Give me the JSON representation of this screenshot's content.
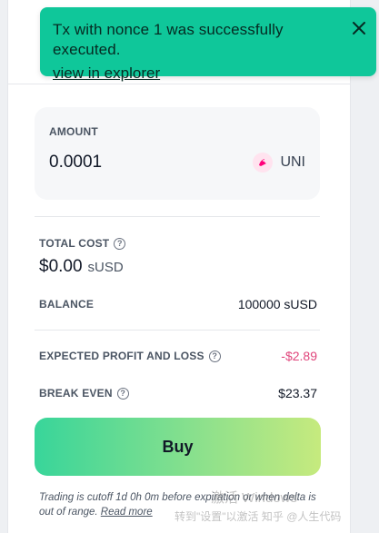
{
  "toast": {
    "title": "Tx with nonce 1 was successfully executed.",
    "link": "view in explorer"
  },
  "amount": {
    "label": "AMOUNT",
    "value": "0.0001",
    "token_symbol": "UNI",
    "token_icon": "uni-token-icon"
  },
  "total_cost": {
    "label": "TOTAL COST",
    "value": "$0.00",
    "unit": "sUSD"
  },
  "balance": {
    "label": "BALANCE",
    "value": "100000 sUSD"
  },
  "pnl": {
    "label": "EXPECTED PROFIT AND LOSS",
    "value": "-$2.89"
  },
  "break_even": {
    "label": "BREAK EVEN",
    "value": "$23.37"
  },
  "buy_button": "Buy",
  "note": {
    "text": "Trading is cutoff 1d 0h 0m before expiration or when delta is out of range.",
    "link": "Read more"
  },
  "watermark": {
    "line1": "激活 Windows",
    "line2": "转到\"设置\"以激活 知乎 @人生代码"
  },
  "colors": {
    "toast_bg": "#0fc79a",
    "pnl_negative": "#e0457b",
    "buy_gradient_start": "#38d59a",
    "buy_gradient_end": "#c6ea7e"
  }
}
